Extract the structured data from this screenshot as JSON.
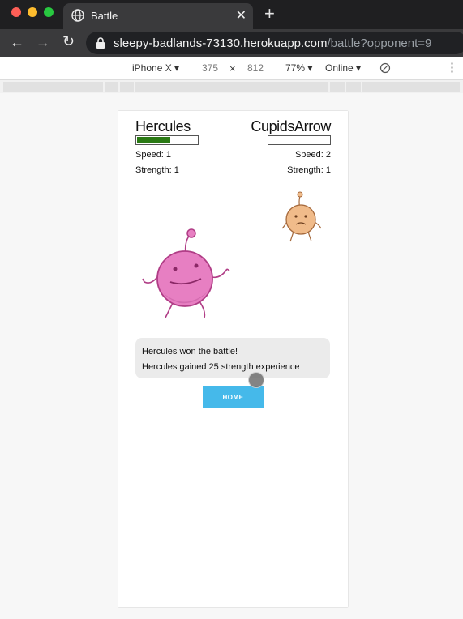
{
  "browser": {
    "tab_title": "Battle",
    "tab_close": "✕",
    "new_tab": "+",
    "url_host": "sleepy-badlands-73130.herokuapp.com",
    "url_path": "/battle?opponent=9"
  },
  "devtools": {
    "device": "iPhone X ▾",
    "width": "375",
    "times": "×",
    "height": "812",
    "zoom": "77% ▾",
    "network": "Online ▾",
    "menu": "⋮"
  },
  "battle": {
    "player": {
      "name": "Hercules",
      "speed": "Speed: 1",
      "strength": "Strength: 1",
      "health_fraction": 0.55,
      "color": "#e77fc2"
    },
    "opponent": {
      "name": "CupidsArrow",
      "speed": "Speed: 2",
      "strength": "Strength: 1",
      "health_fraction": 0,
      "color": "#f0bb8a"
    },
    "messages": [
      "Hercules won the battle!",
      "Hercules gained 25 strength experience"
    ],
    "home_button": "HOME"
  },
  "colors": {
    "health_fill": "#2b7a14",
    "home_button": "#45b9ea"
  }
}
